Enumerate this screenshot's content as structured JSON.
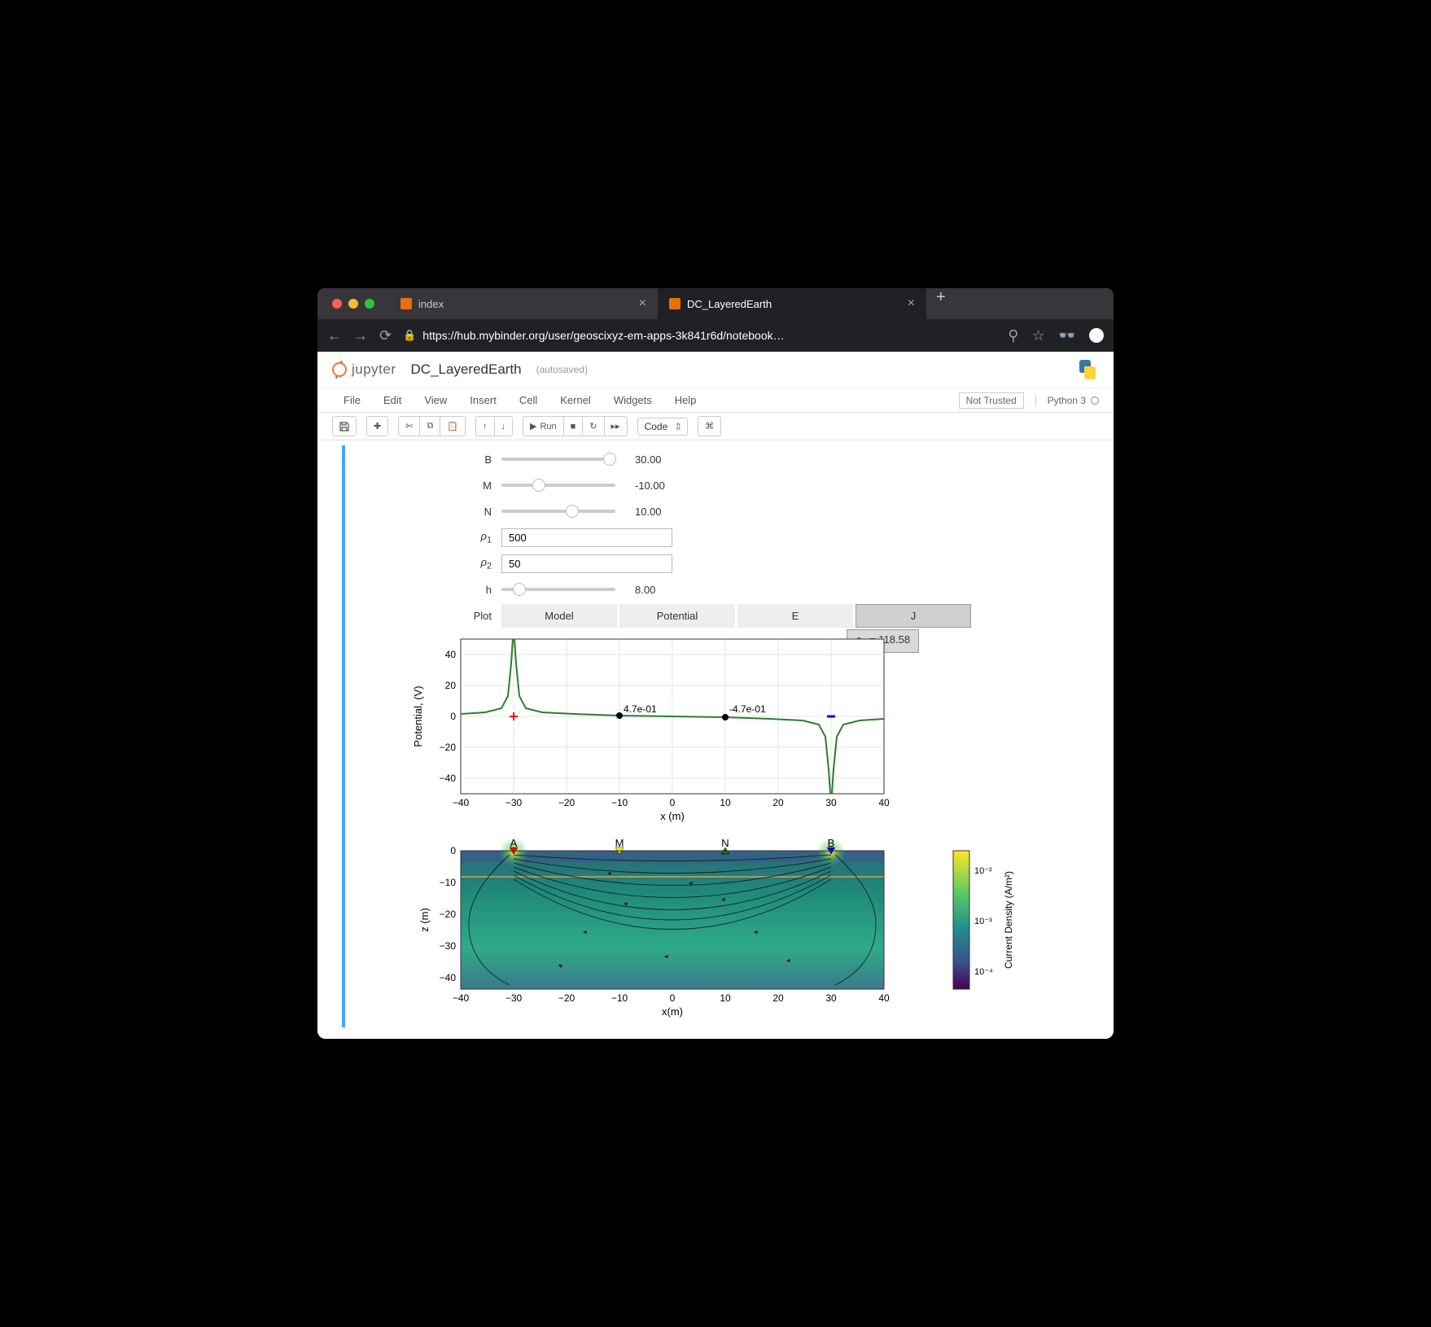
{
  "browser": {
    "tabs": [
      {
        "title": "index",
        "active": false
      },
      {
        "title": "DC_LayeredEarth",
        "active": true
      }
    ],
    "url": "https://hub.mybinder.org/user/geoscixyz-em-apps-3k841r6d/notebook…"
  },
  "jupyter": {
    "logo_text": "jupyter",
    "notebook_title": "DC_LayeredEarth",
    "save_status": "(autosaved)",
    "menu": [
      "File",
      "Edit",
      "View",
      "Insert",
      "Cell",
      "Kernel",
      "Widgets",
      "Help"
    ],
    "trust_label": "Not Trusted",
    "kernel": "Python 3",
    "run_label": "Run",
    "cell_type": "Code"
  },
  "widgets": {
    "B": {
      "label": "B",
      "value": "30.00",
      "pos": 0.95
    },
    "M": {
      "label": "M",
      "value": "-10.00",
      "pos": 0.33
    },
    "N": {
      "label": "N",
      "value": "10.00",
      "pos": 0.62
    },
    "rho1": {
      "label": "ρ1",
      "value": "500"
    },
    "rho2": {
      "label": "ρ2",
      "value": "50"
    },
    "h": {
      "label": "h",
      "value": "8.00",
      "pos": 0.16
    },
    "plot_label": "Plot",
    "plot_options": [
      "Model",
      "Potential",
      "E",
      "J"
    ],
    "plot_active": "J",
    "rho_a": "ρa = 118.58"
  },
  "chart_data": [
    {
      "type": "line",
      "title": "",
      "xlabel": "x (m)",
      "ylabel": "Potential, (V)",
      "xlim": [
        -40,
        40
      ],
      "ylim": [
        -50,
        50
      ],
      "x_ticks": [
        -40,
        -30,
        -20,
        -10,
        0,
        10,
        20,
        30,
        40
      ],
      "y_ticks": [
        -40,
        -20,
        0,
        20,
        40
      ],
      "markers": [
        {
          "x": -30,
          "symbol": "+",
          "color": "red"
        },
        {
          "x": -10,
          "symbol": "●",
          "color": "black",
          "label": "4.7e-01"
        },
        {
          "x": 10,
          "symbol": "●",
          "color": "black",
          "label": "-4.7e-01"
        },
        {
          "x": 30,
          "symbol": "-",
          "color": "blue"
        }
      ],
      "series": [
        {
          "name": "potential",
          "color": "#2e7d32",
          "x": [
            -40,
            -35,
            -32,
            -31,
            -30.5,
            -29.5,
            -29,
            -28,
            -25,
            -20,
            -15,
            -10,
            -5,
            0,
            5,
            10,
            15,
            20,
            25,
            28,
            29,
            29.5,
            30.5,
            31,
            32,
            35,
            40
          ],
          "y": [
            2,
            3,
            8,
            25,
            50,
            50,
            25,
            8,
            3,
            1.5,
            1,
            0.47,
            0.2,
            0,
            -0.2,
            -0.47,
            -1,
            -1.5,
            -3,
            -8,
            -25,
            -50,
            -50,
            -25,
            -8,
            -3,
            -2
          ]
        }
      ]
    },
    {
      "type": "heatmap",
      "xlabel": "x(m)",
      "ylabel": "z (m)",
      "xlim": [
        -40,
        40
      ],
      "ylim": [
        -44,
        0
      ],
      "x_ticks": [
        -40,
        -30,
        -20,
        -10,
        0,
        10,
        20,
        30,
        40
      ],
      "y_ticks": [
        -40,
        -30,
        -20,
        -10,
        0
      ],
      "electrodes": [
        {
          "label": "A",
          "x": -30,
          "color": "red",
          "shape": "down"
        },
        {
          "label": "M",
          "x": -10,
          "color": "yellow",
          "shape": "down"
        },
        {
          "label": "N",
          "x": 10,
          "color": "green",
          "shape": "up"
        },
        {
          "label": "B",
          "x": 30,
          "color": "blue",
          "shape": "down"
        }
      ],
      "colorbar": {
        "label": "Current Density (A/m²)",
        "ticks": [
          "10⁻²",
          "10⁻³",
          "10⁻⁴"
        ]
      },
      "layer_boundary_z": -8
    }
  ]
}
